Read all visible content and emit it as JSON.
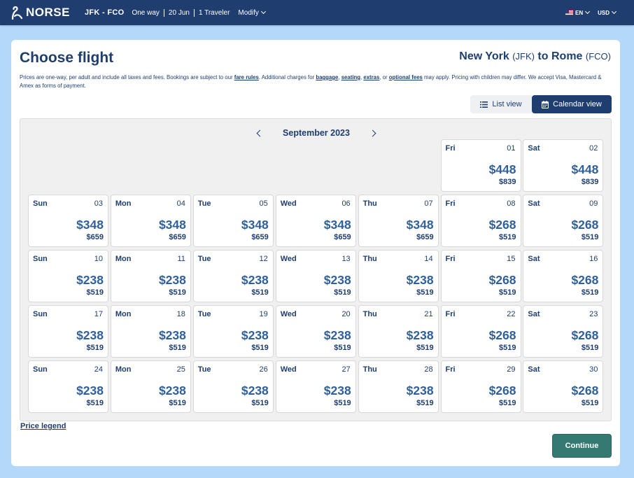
{
  "header": {
    "logo_text": "NORSE",
    "route": "JFK - FCO",
    "trip_type": "One way",
    "date": "20 Jun",
    "travelers": "1 Traveler",
    "modify": "Modify",
    "language": "EN",
    "currency": "USD"
  },
  "page": {
    "title": "Choose flight",
    "origin_city": "New York",
    "origin_code": "(JFK)",
    "to_word": "to",
    "dest_city": "Rome",
    "dest_code": "(FCO)",
    "info": {
      "part1": "Prices are one-way, per adult and include all taxes and fees. Bookings are subject to our ",
      "link_fare_rules": "fare rules",
      "part2": ". Additional charges for ",
      "link_baggage": "baggage",
      "comma1": ", ",
      "link_seating": "seating",
      "comma2": ", ",
      "link_extras": "extras",
      "part3": ", or ",
      "link_optional_fees": "optional fees",
      "part4": " may apply. Pricing with children may differ. We accept Visa, Mastercard & Amex as forms of payment."
    },
    "view_toggle": {
      "list_label": "List view",
      "calendar_label": "Calendar view"
    },
    "calendar": {
      "month": "September 2023",
      "days": [
        {
          "name": "Fri",
          "num": "01",
          "price": "$448",
          "other": "$839"
        },
        {
          "name": "Sat",
          "num": "02",
          "price": "$448",
          "other": "$839"
        },
        {
          "name": "Sun",
          "num": "03",
          "price": "$348",
          "other": "$659"
        },
        {
          "name": "Mon",
          "num": "04",
          "price": "$348",
          "other": "$659"
        },
        {
          "name": "Tue",
          "num": "05",
          "price": "$348",
          "other": "$659"
        },
        {
          "name": "Wed",
          "num": "06",
          "price": "$348",
          "other": "$659"
        },
        {
          "name": "Thu",
          "num": "07",
          "price": "$348",
          "other": "$659"
        },
        {
          "name": "Fri",
          "num": "08",
          "price": "$268",
          "other": "$519"
        },
        {
          "name": "Sat",
          "num": "09",
          "price": "$268",
          "other": "$519"
        },
        {
          "name": "Sun",
          "num": "10",
          "price": "$238",
          "other": "$519"
        },
        {
          "name": "Mon",
          "num": "11",
          "price": "$238",
          "other": "$519"
        },
        {
          "name": "Tue",
          "num": "12",
          "price": "$238",
          "other": "$519"
        },
        {
          "name": "Wed",
          "num": "13",
          "price": "$238",
          "other": "$519"
        },
        {
          "name": "Thu",
          "num": "14",
          "price": "$238",
          "other": "$519"
        },
        {
          "name": "Fri",
          "num": "15",
          "price": "$268",
          "other": "$519"
        },
        {
          "name": "Sat",
          "num": "16",
          "price": "$268",
          "other": "$519"
        },
        {
          "name": "Sun",
          "num": "17",
          "price": "$238",
          "other": "$519"
        },
        {
          "name": "Mon",
          "num": "18",
          "price": "$238",
          "other": "$519"
        },
        {
          "name": "Tue",
          "num": "19",
          "price": "$238",
          "other": "$519"
        },
        {
          "name": "Wed",
          "num": "20",
          "price": "$238",
          "other": "$519"
        },
        {
          "name": "Thu",
          "num": "21",
          "price": "$238",
          "other": "$519"
        },
        {
          "name": "Fri",
          "num": "22",
          "price": "$268",
          "other": "$519"
        },
        {
          "name": "Sat",
          "num": "23",
          "price": "$268",
          "other": "$519"
        },
        {
          "name": "Sun",
          "num": "24",
          "price": "$238",
          "other": "$519"
        },
        {
          "name": "Mon",
          "num": "25",
          "price": "$238",
          "other": "$519"
        },
        {
          "name": "Tue",
          "num": "26",
          "price": "$238",
          "other": "$519"
        },
        {
          "name": "Wed",
          "num": "27",
          "price": "$238",
          "other": "$519"
        },
        {
          "name": "Thu",
          "num": "28",
          "price": "$238",
          "other": "$519"
        },
        {
          "name": "Fri",
          "num": "29",
          "price": "$268",
          "other": "$519"
        },
        {
          "name": "Sat",
          "num": "30",
          "price": "$268",
          "other": "$519"
        }
      ]
    },
    "price_legend": "Price legend",
    "continue_label": "Continue"
  },
  "colors": {
    "header_bg": "#1f3e6f",
    "page_bg": "#b3d8fa",
    "price": "#2f5f9c",
    "continue_bg": "#347a72"
  }
}
